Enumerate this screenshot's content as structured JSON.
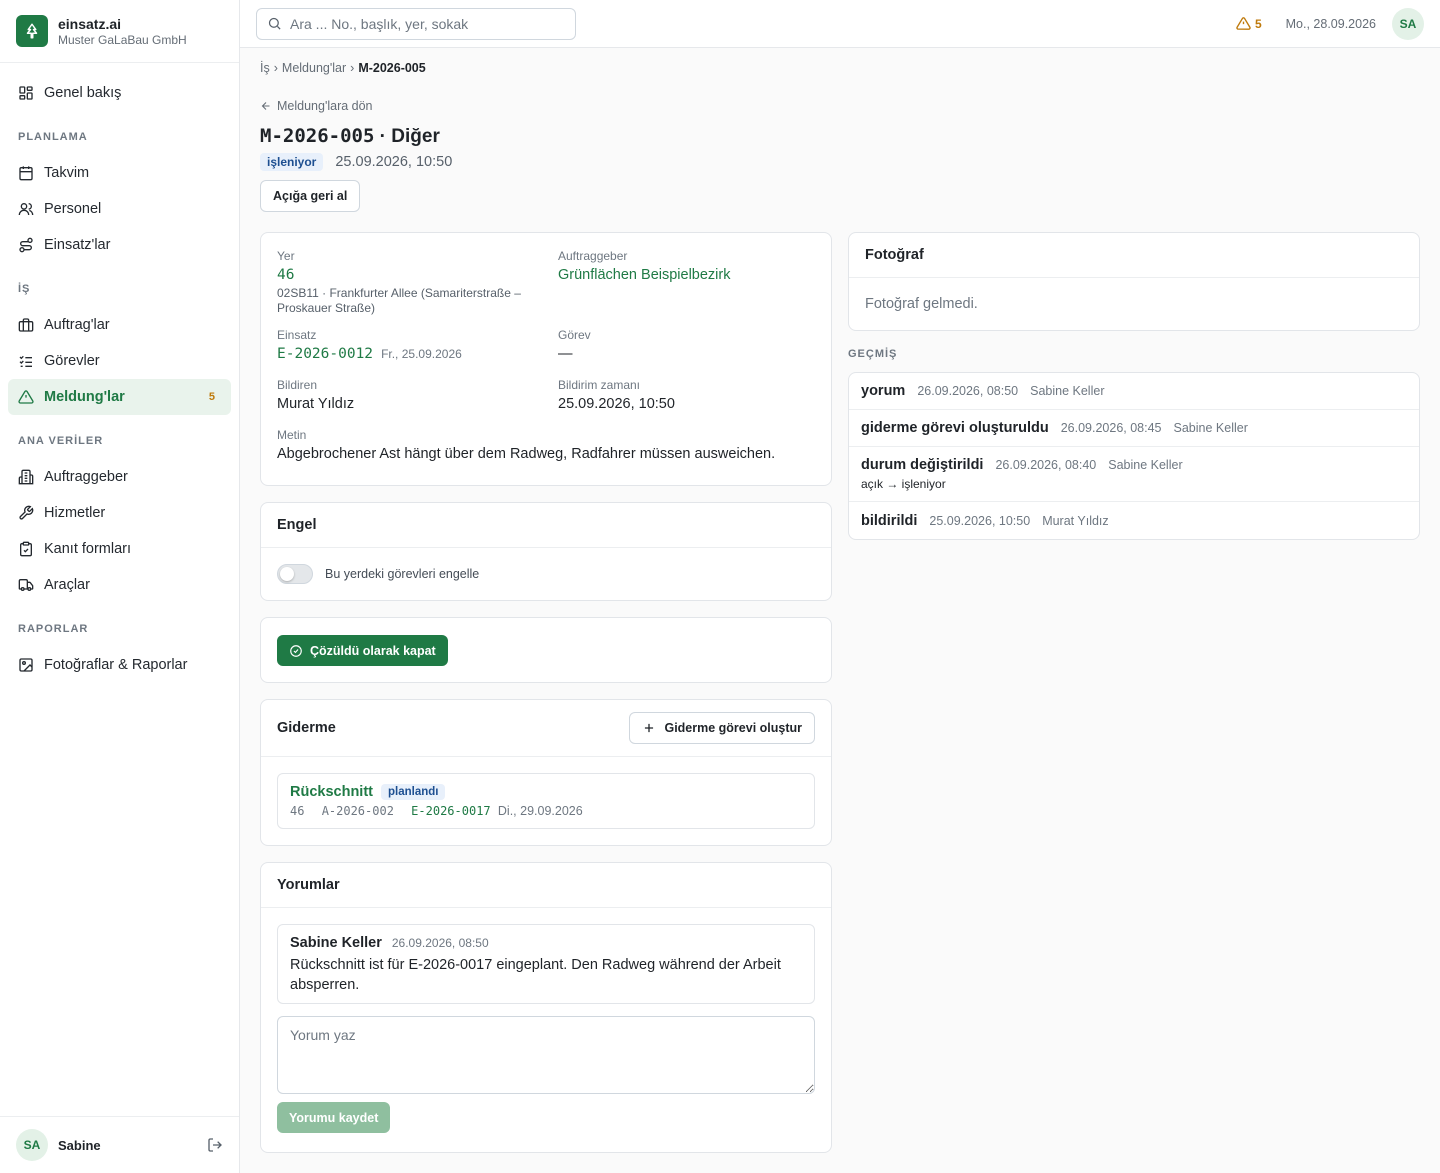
{
  "brand": {
    "name": "einsatz.ai",
    "company": "Muster GaLaBau GmbH"
  },
  "nav": {
    "overview": "Genel bakış",
    "section_planning": "PLANLAMA",
    "calendar": "Takvim",
    "staff": "Personel",
    "deployments": "Einsatz'lar",
    "section_work": "İŞ",
    "orders": "Auftrag'lar",
    "tasks": "Görevler",
    "reports": "Meldung'lar",
    "reports_badge": "5",
    "section_master": "ANA VERİLER",
    "clients": "Auftraggeber",
    "services": "Hizmetler",
    "forms": "Kanıt formları",
    "vehicles": "Araçlar",
    "section_reports": "RAPORLAR",
    "photos": "Fotoğraflar & Raporlar"
  },
  "user": {
    "initials": "SA",
    "name": "Sabine"
  },
  "topbar": {
    "search_placeholder": "Ara ... No., başlık, yer, sokak",
    "alerts": "5",
    "date": "Mo., 28.09.2026",
    "initials": "SA"
  },
  "breadcrumb": {
    "root": "İş",
    "parent": "Meldung'lar",
    "current": "M-2026-005",
    "sep": "›"
  },
  "page": {
    "back": "Meldung'lara dön",
    "title_code": "M-2026-005",
    "title_rest": " · Diğer",
    "status": "işleniyor",
    "created": "25.09.2026, 10:50",
    "revert": "Açığa geri al"
  },
  "details": {
    "place_label": "Yer",
    "place_value": "46",
    "place_address": "02SB11 · Frankfurter Allee (Samariterstraße – Proskauer Straße)",
    "client_label": "Auftraggeber",
    "client_value": "Grünflächen Beispielbezirk",
    "einsatz_label": "Einsatz",
    "einsatz_value": "E-2026-0012",
    "einsatz_date": "Fr., 25.09.2026",
    "task_label": "Görev",
    "task_value": "—",
    "reporter_label": "Bildiren",
    "reporter_value": "Murat Yıldız",
    "reported_label": "Bildirim zamanı",
    "reported_value": "25.09.2026, 10:50",
    "text_label": "Metin",
    "text_value": "Abgebrochener Ast hängt über dem Radweg, Radfahrer müssen ausweichen."
  },
  "block": {
    "title": "Engel",
    "toggle_label": "Bu yerdeki görevleri engelle"
  },
  "resolve": {
    "label": "Çözüldü olarak kapat"
  },
  "remedy": {
    "title": "Giderme",
    "create": "Giderme görevi oluştur",
    "item": {
      "name": "Rückschnitt",
      "status": "planlandı",
      "place": "46",
      "order": "A-2026-002",
      "einsatz": "E-2026-0017",
      "date": "Di., 29.09.2026"
    }
  },
  "comments": {
    "title": "Yorumlar",
    "items": [
      {
        "author": "Sabine Keller",
        "date": "26.09.2026, 08:50",
        "text": "Rückschnitt ist für E-2026-0017 eingeplant. Den Radweg während der Arbeit absperren."
      }
    ],
    "placeholder": "Yorum yaz",
    "save": "Yorumu kaydet"
  },
  "photo": {
    "title": "Fotoğraf",
    "empty": "Fotoğraf gelmedi."
  },
  "history": {
    "label": "GEÇMİŞ",
    "items": [
      {
        "action": "yorum",
        "date": "26.09.2026, 08:50",
        "user": "Sabine Keller"
      },
      {
        "action": "giderme görevi oluşturuldu",
        "date": "26.09.2026, 08:45",
        "user": "Sabine Keller"
      },
      {
        "action": "durum değiştirildi",
        "date": "26.09.2026, 08:40",
        "user": "Sabine Keller",
        "change": "açık → işleniyor"
      },
      {
        "action": "bildirildi",
        "date": "25.09.2026, 10:50",
        "user": "Murat Yıldız"
      }
    ]
  },
  "colors": {
    "accent": "#1f7a45",
    "warning": "#bf7a0c",
    "status_bg": "#e8f0fb"
  }
}
